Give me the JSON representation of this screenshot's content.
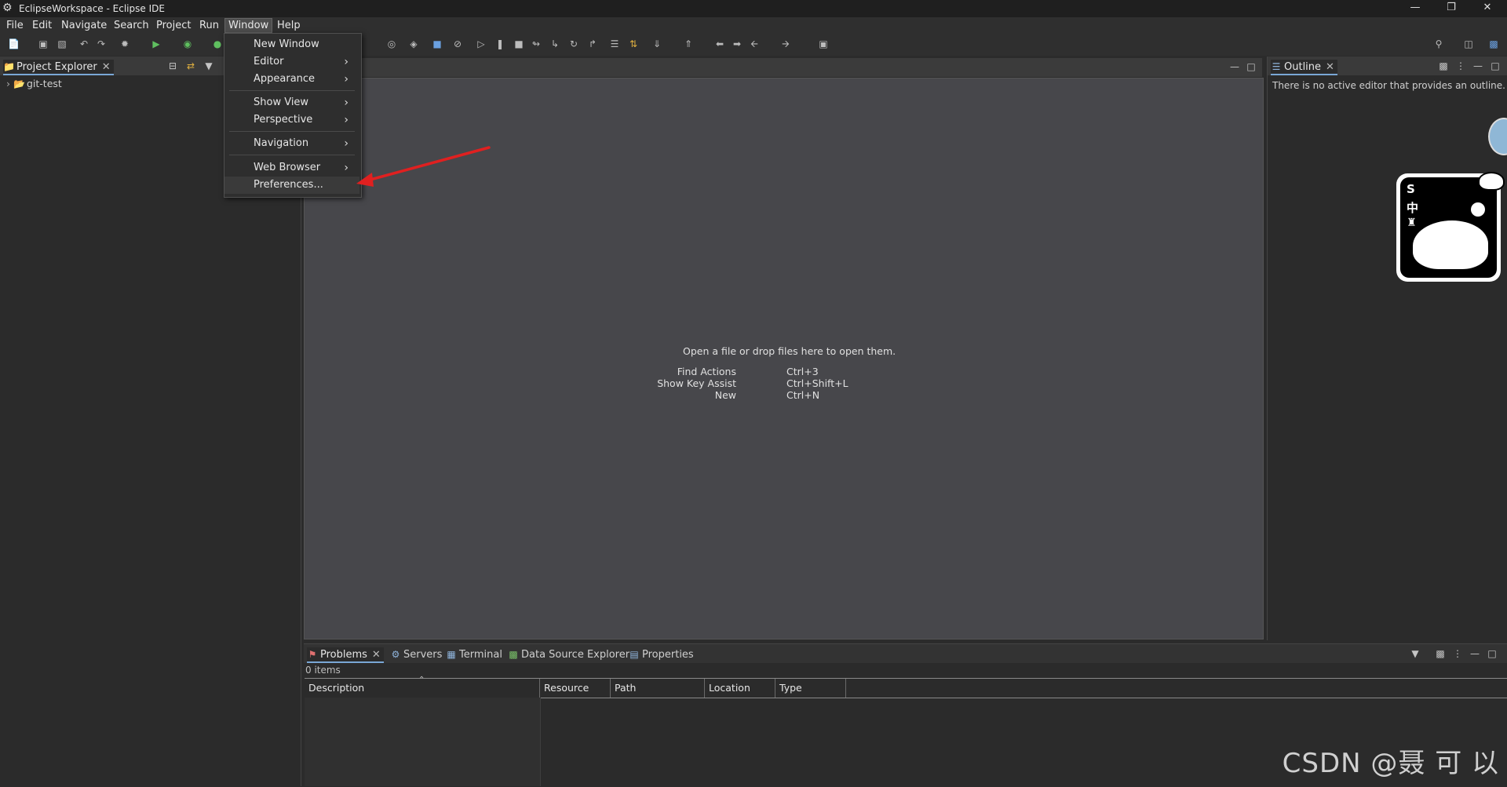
{
  "window": {
    "title": "EclipseWorkspace - Eclipse IDE",
    "controls": [
      "—",
      "❐",
      "✕"
    ]
  },
  "menubar": {
    "items": [
      "File",
      "Edit",
      "Navigate",
      "Search",
      "Project",
      "Run",
      "Window",
      "Help"
    ],
    "active": "Window"
  },
  "window_menu": {
    "items": [
      {
        "label": "New Window",
        "submenu": false
      },
      {
        "label": "Editor",
        "submenu": true
      },
      {
        "label": "Appearance",
        "submenu": true
      },
      {
        "label": "Show View",
        "submenu": true
      },
      {
        "label": "Perspective",
        "submenu": true
      },
      {
        "label": "Navigation",
        "submenu": true
      },
      {
        "label": "Web Browser",
        "submenu": true
      },
      {
        "label": "Preferences...",
        "submenu": false
      }
    ],
    "arrow_glyph": "›"
  },
  "project_explorer": {
    "tab_label": "Project Explorer",
    "items": [
      "git-test"
    ]
  },
  "editor": {
    "hint": "Open a file or drop files here to open them.",
    "shortcuts": [
      {
        "action": "Find Actions",
        "keys": "Ctrl+3"
      },
      {
        "action": "Show Key Assist",
        "keys": "Ctrl+Shift+L"
      },
      {
        "action": "New",
        "keys": "Ctrl+N"
      }
    ]
  },
  "outline": {
    "tab_label": "Outline",
    "message": "There is no active editor that provides an outline."
  },
  "bottom_panel": {
    "tabs": [
      "Problems",
      "Servers",
      "Terminal",
      "Data Source Explorer",
      "Properties"
    ],
    "status": "0 items",
    "columns": [
      "Description",
      "Resource",
      "Path",
      "Location",
      "Type"
    ]
  },
  "overlay_widget": {
    "chars": [
      "S",
      "中"
    ]
  },
  "watermark": "CSDN @聂 可 以",
  "colors": {
    "annotation_arrow": "#e02020",
    "selection": "#7aa7d6"
  }
}
